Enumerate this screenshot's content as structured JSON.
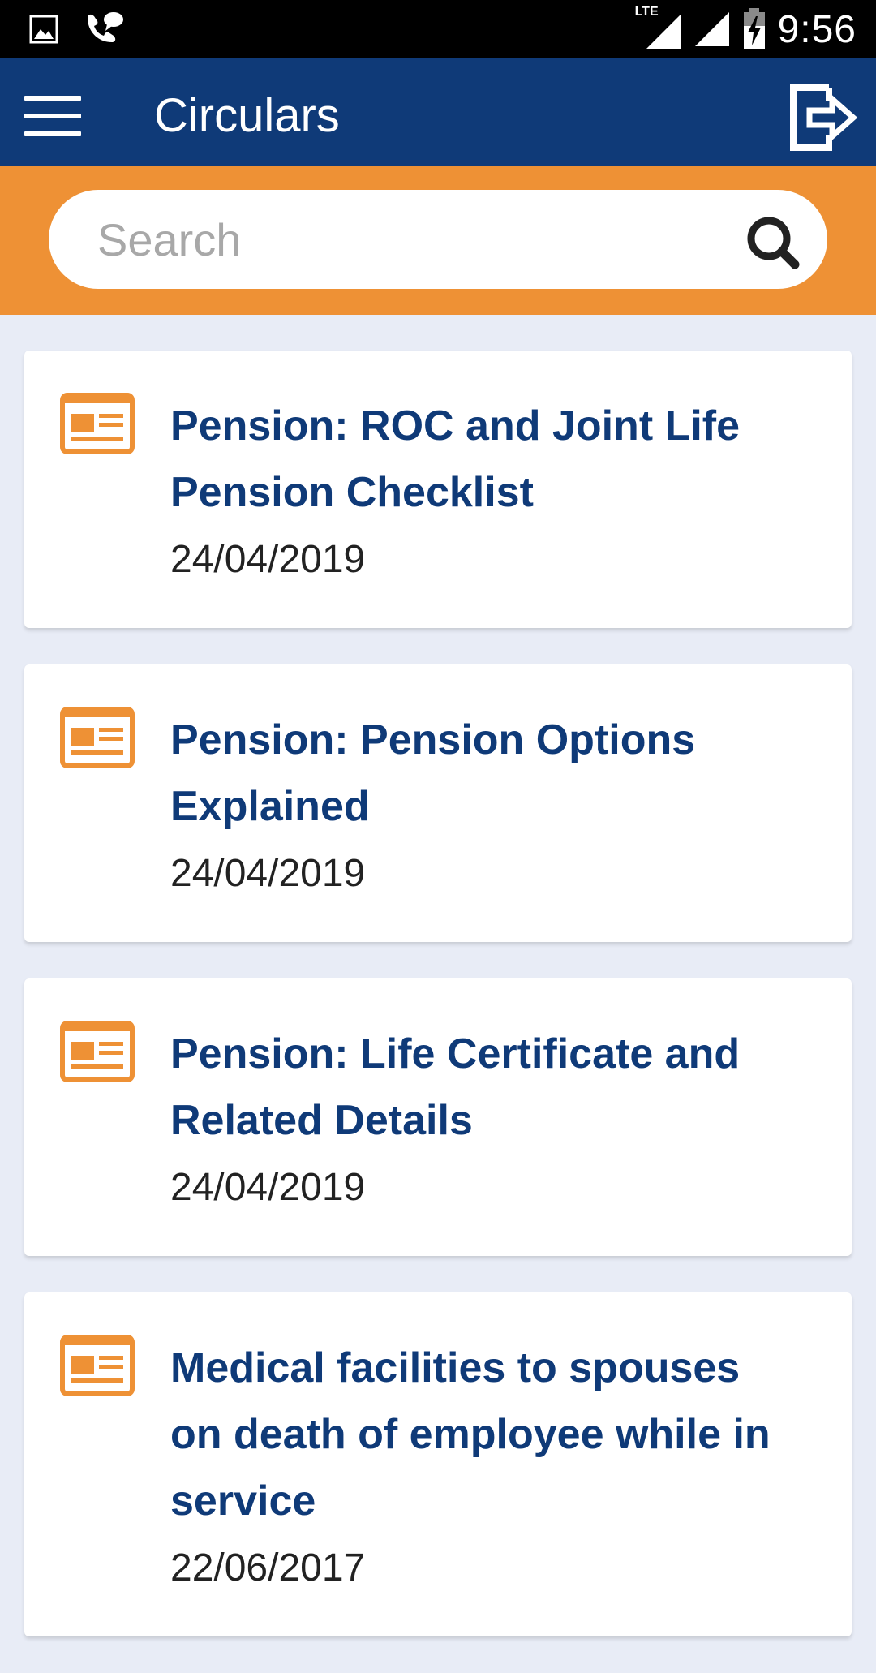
{
  "status_bar": {
    "time": "9:56",
    "network": "LTE"
  },
  "app_bar": {
    "title": "Circulars"
  },
  "search": {
    "placeholder": "Search",
    "value": ""
  },
  "circulars": [
    {
      "title": "Pension: ROC and Joint Life Pension Checklist",
      "date": "24/04/2019"
    },
    {
      "title": "Pension: Pension Options Explained",
      "date": "24/04/2019"
    },
    {
      "title": "Pension: Life Certificate and Related Details",
      "date": "24/04/2019"
    },
    {
      "title": "Medical facilities to spouses on death of employee while in service",
      "date": "22/06/2017"
    }
  ],
  "colors": {
    "primary": "#0f3a78",
    "accent": "#ee9135",
    "background": "#e8ecf6"
  }
}
